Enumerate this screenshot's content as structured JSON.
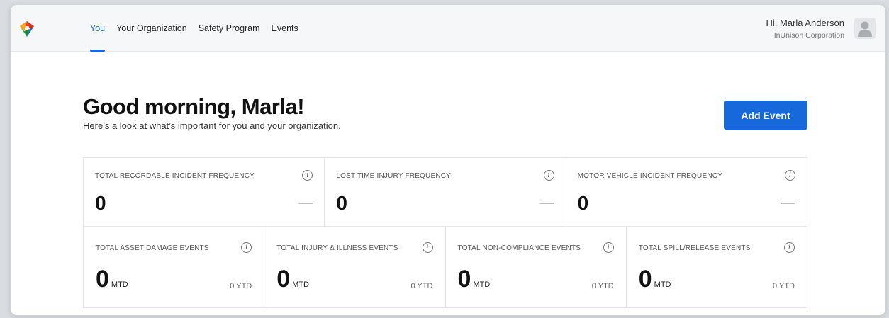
{
  "nav": {
    "items": [
      {
        "label": "You",
        "active": true
      },
      {
        "label": "Your Organization",
        "active": false
      },
      {
        "label": "Safety Program",
        "active": false
      },
      {
        "label": "Events",
        "active": false
      }
    ]
  },
  "user": {
    "greeting": "Hi, Marla Anderson",
    "org": "InUnison Corporation",
    "avatar_icon": "user-silhouette-icon"
  },
  "header": {
    "title": "Good morning, Marla!",
    "subtitle": "Here’s a look at what’s important for you and your organization.",
    "add_event_label": "Add Event"
  },
  "frequency_cards": [
    {
      "label": "TOTAL RECORDABLE INCIDENT FREQUENCY",
      "value": "0",
      "trend": "—"
    },
    {
      "label": "LOST TIME INJURY FREQUENCY",
      "value": "0",
      "trend": "—"
    },
    {
      "label": "MOTOR VEHICLE INCIDENT FREQUENCY",
      "value": "0",
      "trend": "—"
    }
  ],
  "event_cards": [
    {
      "label": "TOTAL ASSET DAMAGE EVENTS",
      "mtd_value": "0",
      "mtd_unit": "MTD",
      "ytd_value": "0",
      "ytd_unit": "YTD"
    },
    {
      "label": "TOTAL INJURY & ILLNESS EVENTS",
      "mtd_value": "0",
      "mtd_unit": "MTD",
      "ytd_value": "0",
      "ytd_unit": "YTD"
    },
    {
      "label": "TOTAL NON-COMPLIANCE EVENTS",
      "mtd_value": "0",
      "mtd_unit": "MTD",
      "ytd_value": "0",
      "ytd_unit": "YTD"
    },
    {
      "label": "TOTAL SPILL/RELEASE EVENTS",
      "mtd_value": "0",
      "mtd_unit": "MTD",
      "ytd_value": "0",
      "ytd_unit": "YTD"
    }
  ],
  "colors": {
    "accent": "#1767d7",
    "logo_red": "#e8452f",
    "logo_blue": "#1f5fc4",
    "logo_green": "#25b24a",
    "logo_orange": "#f4a51c"
  }
}
